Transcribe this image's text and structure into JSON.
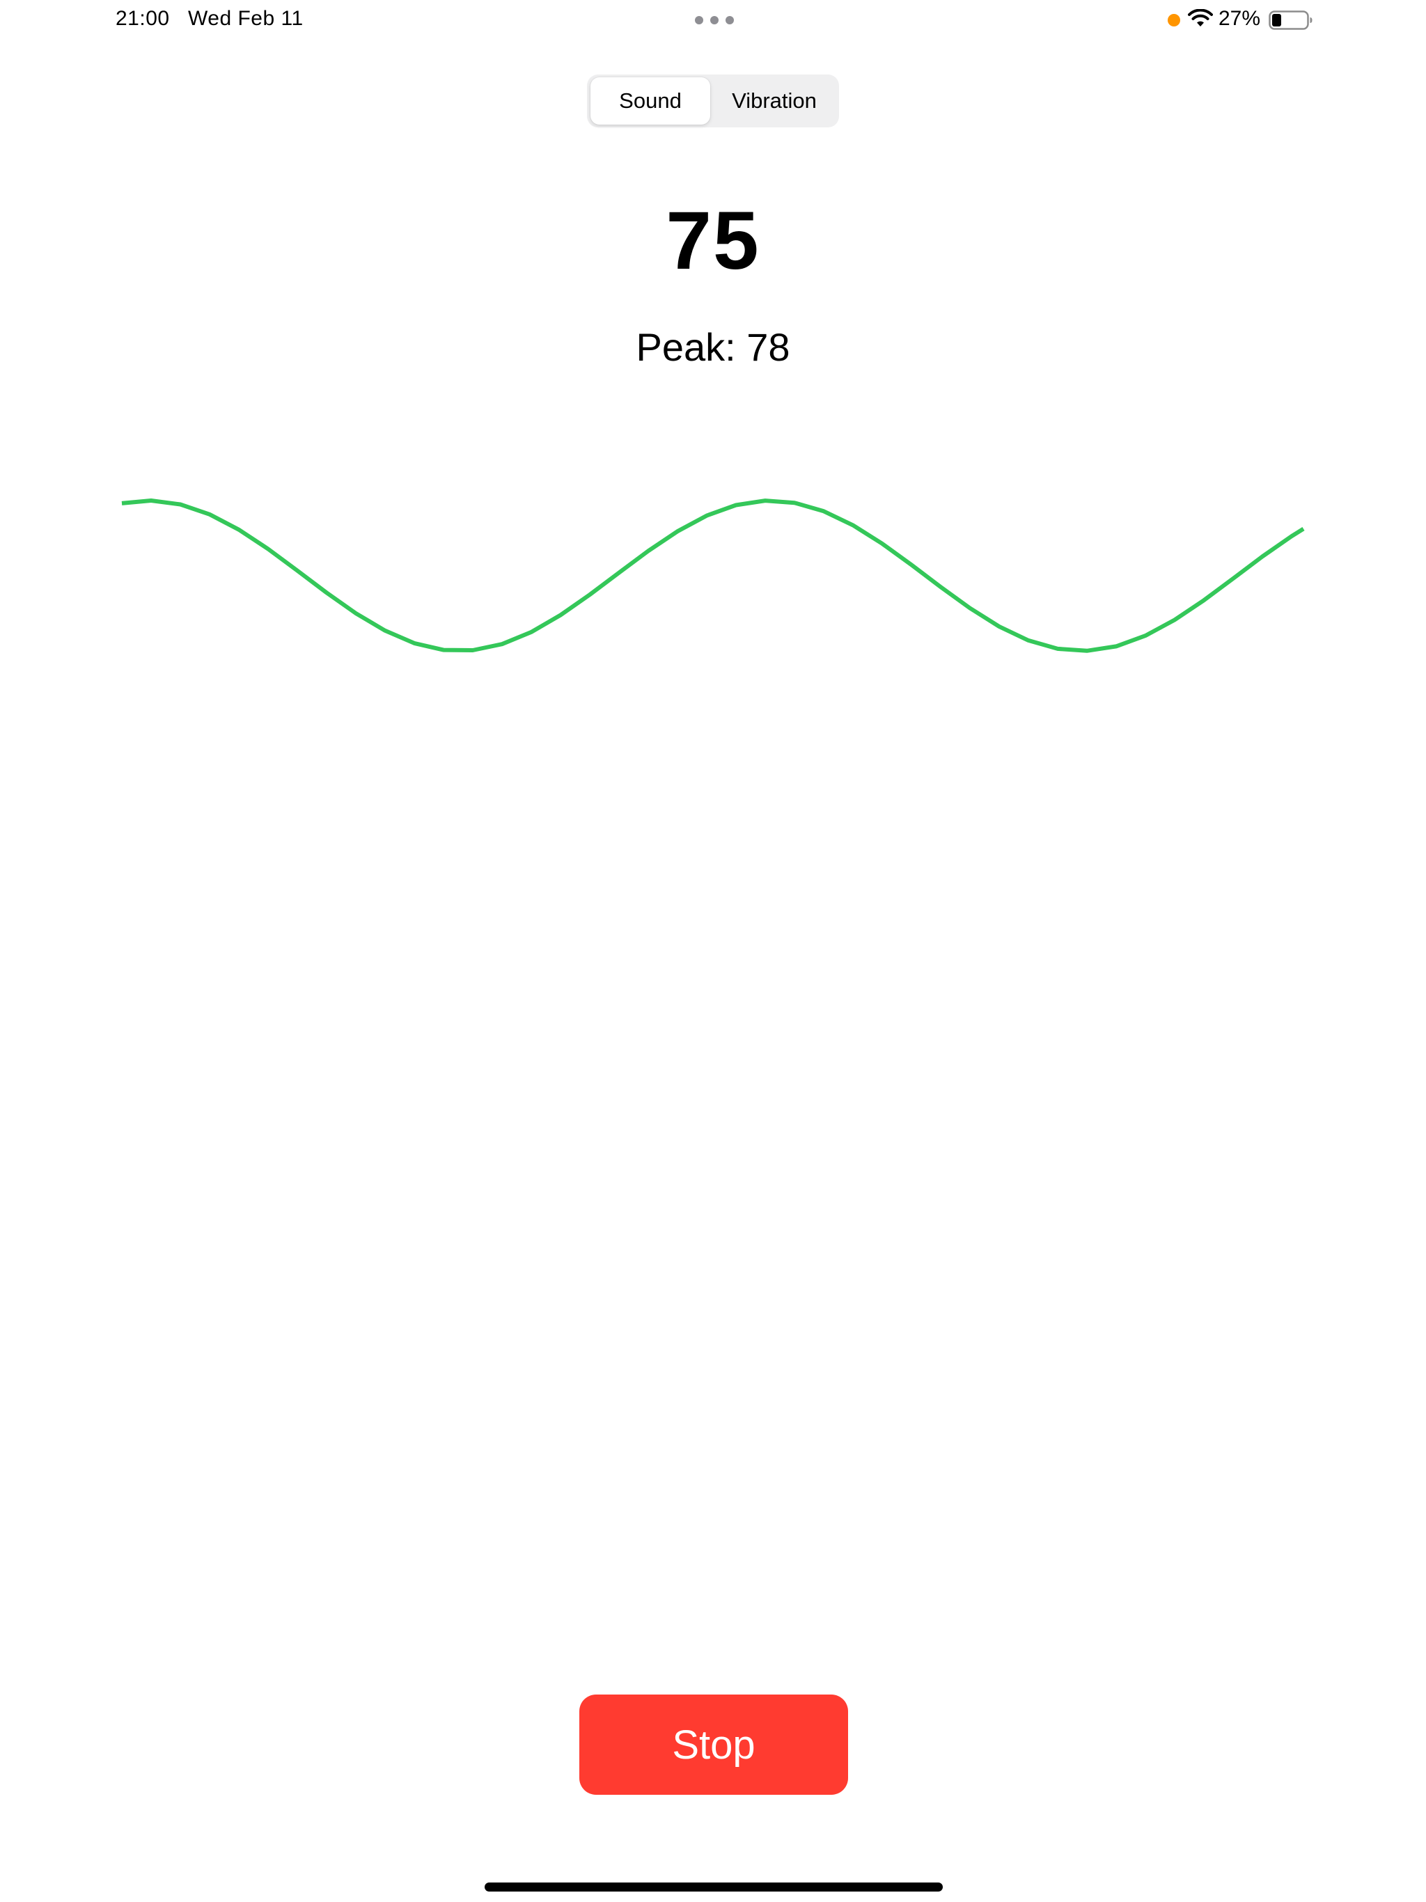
{
  "status_bar": {
    "time": "21:00",
    "date": "Wed Feb 11",
    "battery_percent": "27%",
    "battery_level": 0.27,
    "icons": [
      "multitasking-dots-icon",
      "privacy-indicator-icon",
      "wifi-icon",
      "battery-icon"
    ]
  },
  "segmented_control": {
    "options": [
      "Sound",
      "Vibration"
    ],
    "selected": "Sound"
  },
  "reading": {
    "value": "75",
    "peak_text": "Peak: 78"
  },
  "stop_button": {
    "label": "Stop"
  },
  "colors": {
    "waveform": "#34c759",
    "stop_button": "#ff3b30",
    "privacy_indicator": "#ff9500"
  }
}
